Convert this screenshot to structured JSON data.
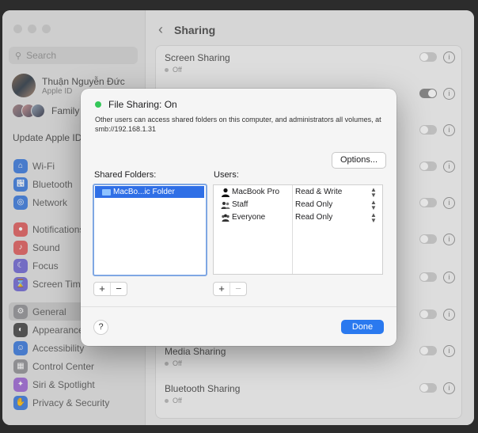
{
  "sidebar": {
    "search_placeholder": "Search",
    "user": {
      "name": "Thuận Nguyễn Đức",
      "subtitle": "Apple ID"
    },
    "family_label": "Family",
    "update_label": "Update Apple ID",
    "items": [
      {
        "label": "Wi-Fi",
        "icon": "wifi-icon",
        "color": "#3b82f6"
      },
      {
        "label": "Bluetooth",
        "icon": "bluetooth-icon",
        "color": "#3b82f6"
      },
      {
        "label": "Network",
        "icon": "globe-icon",
        "color": "#3b82f6"
      },
      {
        "label": "Notifications",
        "icon": "bell-icon",
        "color": "#ef4444"
      },
      {
        "label": "Sound",
        "icon": "speaker-icon",
        "color": "#ef4444"
      },
      {
        "label": "Focus",
        "icon": "moon-icon",
        "color": "#6366f1"
      },
      {
        "label": "Screen Time",
        "icon": "hourglass-icon",
        "color": "#6366f1"
      },
      {
        "label": "General",
        "icon": "gear-icon",
        "color": "#8e8e93"
      },
      {
        "label": "Appearance",
        "icon": "appearance-icon",
        "color": "#1c1c1e"
      },
      {
        "label": "Accessibility",
        "icon": "accessibility-icon",
        "color": "#3b82f6"
      },
      {
        "label": "Control Center",
        "icon": "control-center-icon",
        "color": "#8e8e93"
      },
      {
        "label": "Siri & Spotlight",
        "icon": "siri-icon",
        "color": "#a855f7"
      },
      {
        "label": "Privacy & Security",
        "icon": "hand-icon",
        "color": "#3b82f6"
      }
    ]
  },
  "main": {
    "title": "Sharing",
    "settings": [
      {
        "name": "Screen Sharing",
        "status": "Off",
        "on": false
      },
      {
        "name": "Media Sharing",
        "status": "Off",
        "on": false
      },
      {
        "name": "Bluetooth Sharing",
        "status": "Off",
        "on": false
      }
    ]
  },
  "dialog": {
    "title": "File Sharing: On",
    "status_color": "#34c759",
    "description": "Other users can access shared folders on this computer, and administrators all volumes, at smb://192.168.1.31",
    "options_label": "Options...",
    "shared_folders_label": "Shared Folders:",
    "users_label": "Users:",
    "folders": [
      {
        "name": "MacBo...ic Folder"
      }
    ],
    "users": [
      {
        "name": "MacBook Pro",
        "permission": "Read & Write",
        "icon": "person-icon"
      },
      {
        "name": "Staff",
        "permission": "Read Only",
        "icon": "group-icon"
      },
      {
        "name": "Everyone",
        "permission": "Read Only",
        "icon": "everyone-icon"
      }
    ],
    "add_label": "+",
    "remove_label": "−",
    "help_label": "?",
    "done_label": "Done"
  }
}
